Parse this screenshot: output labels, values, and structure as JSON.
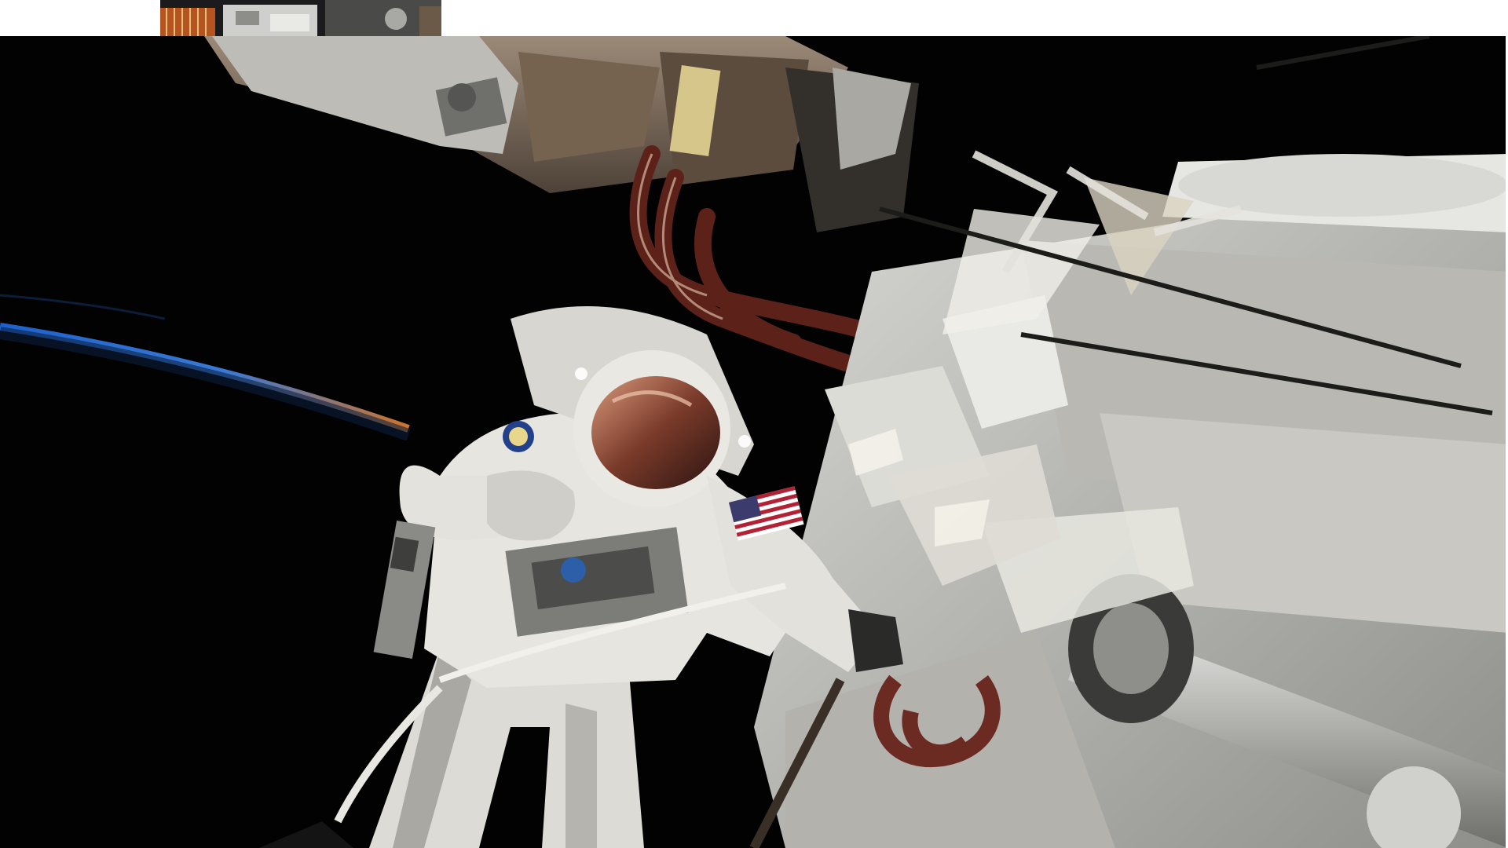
{
  "scene": {
    "subject": "astronaut-spacewalk",
    "colors": {
      "space": "#020203",
      "horizon_glow": "#2a6fd6",
      "horizon_orange": "#d8722a",
      "suit": "#e6e6e3",
      "suit_shadow": "#9a9a96",
      "station_metal": "#8a7a6a",
      "module_white": "#cfcfcb",
      "hose_red": "#6b2a22",
      "visor_gold": "#b06a4a"
    },
    "icons": {
      "flag": "us-flag-icon",
      "patch": "mission-patch-icon"
    }
  }
}
